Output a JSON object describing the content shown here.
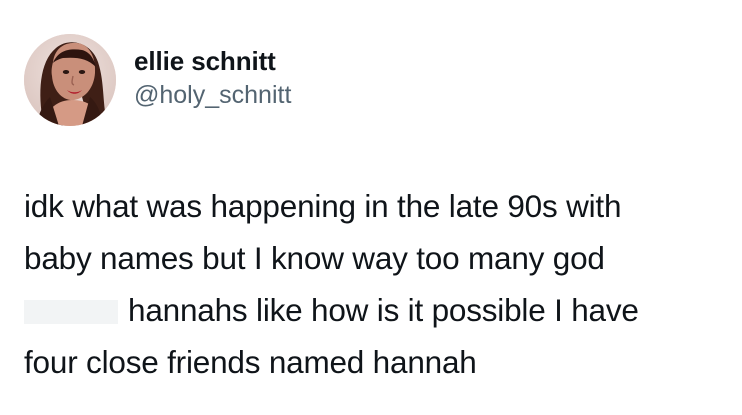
{
  "tweet": {
    "author": {
      "display_name": "ellie schnitt",
      "handle": "@holy_schnitt"
    },
    "body": {
      "line_1": "idk what was happening in the late 90s with",
      "line_2": "baby names but I know way too many god",
      "line_3": "hannahs like how is it possible I have",
      "line_4": "four close friends named hannah"
    }
  },
  "colors": {
    "text": "#0f1419",
    "handle": "#536471",
    "background": "#ffffff",
    "redaction": "#f2f4f5"
  },
  "icons": [
    "avatar"
  ]
}
